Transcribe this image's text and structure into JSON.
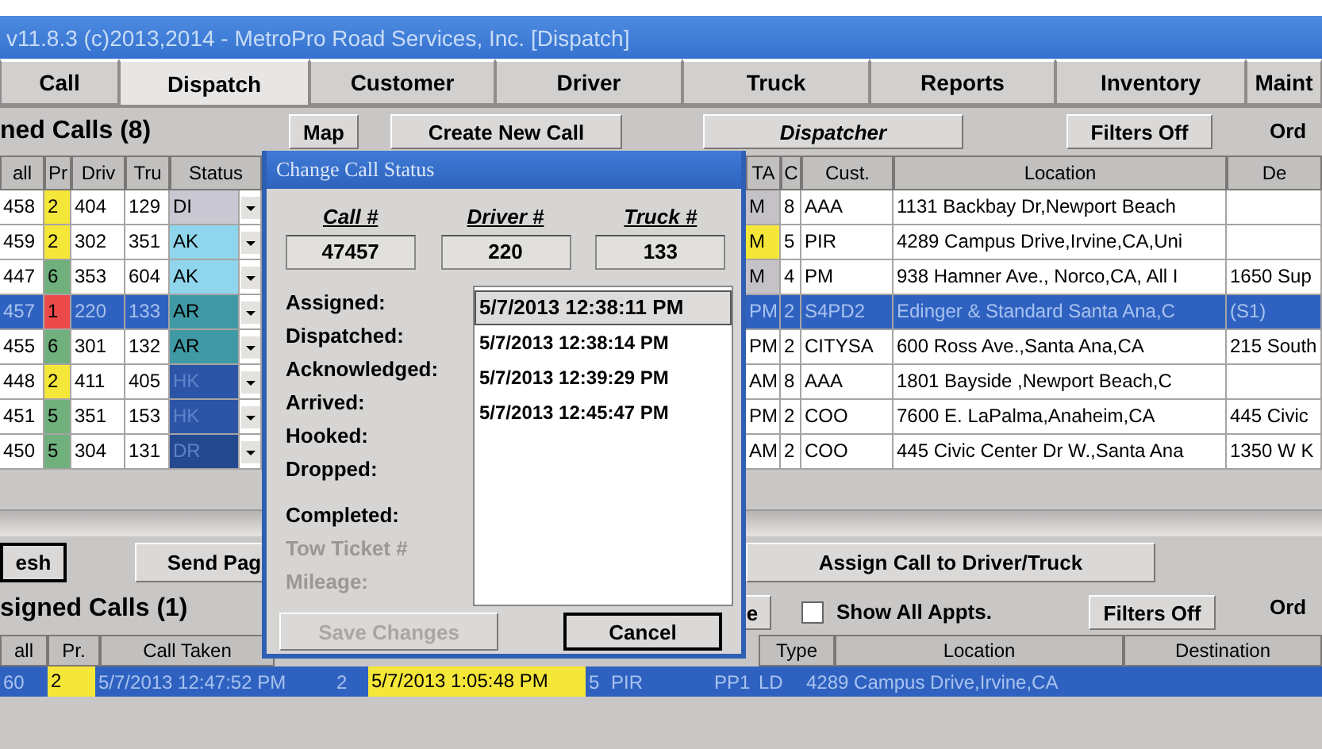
{
  "window": {
    "title": "v11.8.3 (c)2013,2014 - MetroPro Road Services, Inc.  [Dispatch]"
  },
  "tabs": [
    {
      "label": "Call",
      "selected": false
    },
    {
      "label": "Dispatch",
      "selected": true
    },
    {
      "label": "Customer",
      "selected": false
    },
    {
      "label": "Driver",
      "selected": false
    },
    {
      "label": "Truck",
      "selected": false
    },
    {
      "label": "Reports",
      "selected": false
    },
    {
      "label": "Inventory",
      "selected": false
    },
    {
      "label": "Maint",
      "selected": false
    }
  ],
  "assigned": {
    "heading": "ned Calls (8)",
    "buttons": [
      {
        "label": "Map",
        "italic": false
      },
      {
        "label": "Create New Call",
        "italic": false
      },
      {
        "label": "Dispatcher",
        "italic": true
      },
      {
        "label": "Filters Off",
        "italic": false
      }
    ],
    "order_label": "Ord",
    "columns_left": [
      "all",
      "Pr",
      "Driv",
      "Tru",
      "Status"
    ],
    "columns_right": [
      "TA",
      "C",
      "Cust.",
      "Location",
      "De"
    ],
    "rows": [
      {
        "call": "458",
        "priority": {
          "text": "2",
          "color": "#f5e63a"
        },
        "driver": "404",
        "truck": "129",
        "status": {
          "text": "DI",
          "color": "#c9c7d2"
        },
        "ta": {
          "text": "M",
          "color": "#c4c2c6"
        },
        "c": "8",
        "cust": "AAA",
        "location": "1131 Backbay Dr,Newport Beach",
        "destination": "",
        "selected": false
      },
      {
        "call": "459",
        "priority": {
          "text": "2",
          "color": "#f5e63a"
        },
        "driver": "302",
        "truck": "351",
        "status": {
          "text": "AK",
          "color": "#8fd6ec"
        },
        "ta": {
          "text": "M",
          "color": "#f5e63a"
        },
        "c": "5",
        "cust": "PIR",
        "location": "4289 Campus Drive,Irvine,CA,Uni",
        "destination": "",
        "selected": false
      },
      {
        "call": "447",
        "priority": {
          "text": "6",
          "color": "#6fb07c"
        },
        "driver": "353",
        "truck": "604",
        "status": {
          "text": "AK",
          "color": "#8fd6ec"
        },
        "ta": {
          "text": "M",
          "color": "#c4c2c6"
        },
        "c": "4",
        "cust": "PM",
        "location": "938 Hamner Ave., Norco,CA, All I",
        "destination": "1650 Sup",
        "selected": false
      },
      {
        "call": "457",
        "priority": {
          "text": "1",
          "color": "#ec4a4a"
        },
        "driver": "220",
        "truck": "133",
        "status": {
          "text": "AR",
          "color": "#3f9aa5"
        },
        "ta": {
          "text": "PM",
          "color": "#2f62c0"
        },
        "c": "2",
        "cust": "S4PD2",
        "location": "Edinger & Standard Santa Ana,C",
        "destination": "(S1)",
        "selected": true
      },
      {
        "call": "455",
        "priority": {
          "text": "6",
          "color": "#6fb07c"
        },
        "driver": "301",
        "truck": "132",
        "status": {
          "text": "AR",
          "color": "#3f9aa5"
        },
        "ta": {
          "text": "PM",
          "color": "#ffffff"
        },
        "c": "2",
        "cust": "CITYSA",
        "location": "600 Ross Ave.,Santa Ana,CA",
        "destination": "215 South",
        "selected": false
      },
      {
        "call": "448",
        "priority": {
          "text": "2",
          "color": "#f5e63a"
        },
        "driver": "411",
        "truck": "405",
        "status": {
          "text": "HK",
          "color": "#2c55a8"
        },
        "ta": {
          "text": "AM",
          "color": "#ffffff"
        },
        "c": "8",
        "cust": "AAA",
        "location": "1801 Bayside ,Newport Beach,C",
        "destination": "",
        "selected": false
      },
      {
        "call": "451",
        "priority": {
          "text": "5",
          "color": "#6fb07c"
        },
        "driver": "351",
        "truck": "153",
        "status": {
          "text": "HK",
          "color": "#2c55a8"
        },
        "ta": {
          "text": "PM",
          "color": "#ffffff"
        },
        "c": "2",
        "cust": "COO",
        "location": "7600 E. LaPalma,Anaheim,CA",
        "destination": "445 Civic",
        "selected": false
      },
      {
        "call": "450",
        "priority": {
          "text": "5",
          "color": "#6fb07c"
        },
        "driver": "304",
        "truck": "131",
        "status": {
          "text": "DR",
          "color": "#24498f"
        },
        "ta": {
          "text": "AM",
          "color": "#ffffff"
        },
        "c": "2",
        "cust": "COO",
        "location": "445 Civic Center Dr W.,Santa Ana",
        "destination": "1350 W K",
        "selected": false
      }
    ]
  },
  "actions": [
    {
      "label": "esh",
      "default": true
    },
    {
      "label": "Send Pag",
      "default": false
    },
    {
      "label": "Assign Call to Driver/Truck",
      "default": false
    }
  ],
  "unassigned": {
    "heading": "signed Calls (1)",
    "partial_button": "e",
    "checkbox": {
      "label": "Show All Appts.",
      "checked": false
    },
    "filter_button": "Filters Off",
    "order_label": "Ord",
    "columns_left": [
      "all",
      "Pr.",
      "Call Taken"
    ],
    "columns_right": [
      "Type",
      "Location",
      "Destination"
    ],
    "row": {
      "call": "60",
      "priority": {
        "text": "2",
        "color": "#f5e63a"
      },
      "taken": "5/7/2013 12:47:52 PM",
      "column_4": "2",
      "eta": {
        "text": "5/7/2013 1:05:48 PM",
        "color": "#f5e63a"
      },
      "c": "5",
      "cust": "PIR",
      "area": "PP1",
      "type": "LD",
      "location": "4289 Campus Drive,Irvine,CA",
      "selected": true
    }
  },
  "dialog": {
    "title": "Change Call Status",
    "ids": [
      {
        "label": "Call #",
        "value": "47457"
      },
      {
        "label": "Driver #",
        "value": "220"
      },
      {
        "label": "Truck #",
        "value": "133"
      }
    ],
    "fields": [
      {
        "label": "Assigned:",
        "disabled": false
      },
      {
        "label": "Dispatched:",
        "disabled": false
      },
      {
        "label": "Acknowledged:",
        "disabled": false
      },
      {
        "label": "Arrived:",
        "disabled": false
      },
      {
        "label": "Hooked:",
        "disabled": false
      },
      {
        "label": "Dropped:",
        "disabled": false
      },
      {
        "label": "Completed:",
        "disabled": false
      },
      {
        "label": "Tow Ticket #",
        "disabled": true
      },
      {
        "label": "Mileage:",
        "disabled": true
      }
    ],
    "times": [
      {
        "value": "5/7/2013 12:38:11 PM",
        "selected": true
      },
      {
        "value": "5/7/2013 12:38:14 PM",
        "selected": false
      },
      {
        "value": "5/7/2013 12:39:29 PM",
        "selected": false
      },
      {
        "value": "5/7/2013 12:45:47 PM",
        "selected": false
      }
    ],
    "buttons": [
      {
        "label": "Save Changes",
        "disabled": true,
        "default": false
      },
      {
        "label": "Cancel",
        "disabled": false,
        "default": true
      }
    ]
  }
}
